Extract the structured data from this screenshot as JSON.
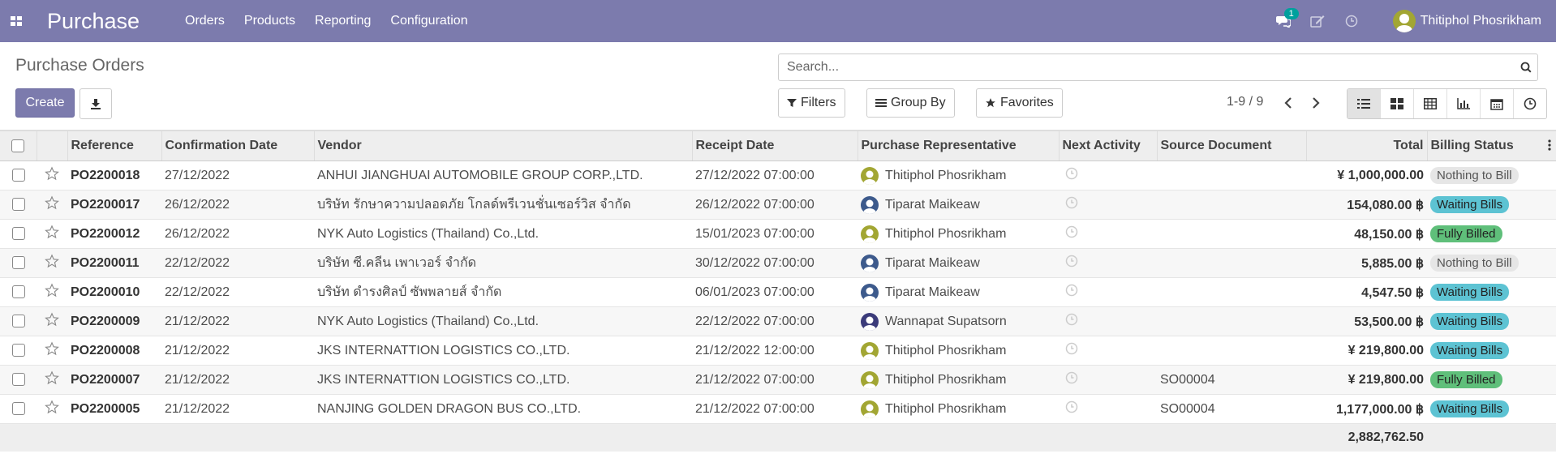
{
  "app": {
    "title": "Purchase"
  },
  "menu": [
    {
      "label": "Orders"
    },
    {
      "label": "Products"
    },
    {
      "label": "Reporting"
    },
    {
      "label": "Configuration"
    }
  ],
  "topbar": {
    "message_count": "1",
    "user_name": "Thitiphol Phosrikham"
  },
  "page": {
    "title": "Purchase Orders",
    "create_label": "Create",
    "search_placeholder": "Search...",
    "filters_label": "Filters",
    "groupby_label": "Group By",
    "favorites_label": "Favorites",
    "pager": "1-9 / 9"
  },
  "colors": {
    "brand": "#7c7bad",
    "waiting": "#5dc3d3",
    "billed": "#5fbf7a",
    "nothing": "#e6e6e6"
  },
  "table": {
    "headers": {
      "reference": "Reference",
      "confirmation": "Confirmation Date",
      "vendor": "Vendor",
      "receipt": "Receipt Date",
      "rep": "Purchase Representative",
      "activity": "Next Activity",
      "source": "Source Document",
      "total": "Total",
      "billing": "Billing Status"
    },
    "rows": [
      {
        "ref": "PO2200018",
        "confirm": "27/12/2022",
        "vendor": "ANHUI JIANGHUAI AUTOMOBILE GROUP CORP.,LTD.",
        "receipt": "27/12/2022 07:00:00",
        "rep": "Thitiphol Phosrikham",
        "source": "",
        "total": "¥ 1,000,000.00",
        "billing": "Nothing to Bill"
      },
      {
        "ref": "PO2200017",
        "confirm": "26/12/2022",
        "vendor": "บริษัท รักษาความปลอดภัย โกลด์พรีเวนชั่นเซอร์วิส จำกัด",
        "receipt": "26/12/2022 07:00:00",
        "rep": "Tiparat Maikeaw",
        "source": "",
        "total": "154,080.00 ฿",
        "billing": "Waiting Bills"
      },
      {
        "ref": "PO2200012",
        "confirm": "26/12/2022",
        "vendor": "NYK Auto Logistics (Thailand) Co.,Ltd.",
        "receipt": "15/01/2023 07:00:00",
        "rep": "Thitiphol Phosrikham",
        "source": "",
        "total": "48,150.00 ฿",
        "billing": "Fully Billed"
      },
      {
        "ref": "PO2200011",
        "confirm": "22/12/2022",
        "vendor": "บริษัท ซี.คลีน เพาเวอร์ จำกัด",
        "receipt": "30/12/2022 07:00:00",
        "rep": "Tiparat Maikeaw",
        "source": "",
        "total": "5,885.00 ฿",
        "billing": "Nothing to Bill"
      },
      {
        "ref": "PO2200010",
        "confirm": "22/12/2022",
        "vendor": "บริษัท ดำรงศิลป์ ซัพพลายส์ จำกัด",
        "receipt": "06/01/2023 07:00:00",
        "rep": "Tiparat Maikeaw",
        "source": "",
        "total": "4,547.50 ฿",
        "billing": "Waiting Bills"
      },
      {
        "ref": "PO2200009",
        "confirm": "21/12/2022",
        "vendor": "NYK Auto Logistics (Thailand) Co.,Ltd.",
        "receipt": "22/12/2022 07:00:00",
        "rep": "Wannapat Supatsorn",
        "source": "",
        "total": "53,500.00 ฿",
        "billing": "Waiting Bills"
      },
      {
        "ref": "PO2200008",
        "confirm": "21/12/2022",
        "vendor": "JKS INTERNATTION LOGISTICS CO.,LTD.",
        "receipt": "21/12/2022 12:00:00",
        "rep": "Thitiphol Phosrikham",
        "source": "",
        "total": "¥ 219,800.00",
        "billing": "Waiting Bills"
      },
      {
        "ref": "PO2200007",
        "confirm": "21/12/2022",
        "vendor": "JKS INTERNATTION LOGISTICS CO.,LTD.",
        "receipt": "21/12/2022 07:00:00",
        "rep": "Thitiphol Phosrikham",
        "source": "SO00004",
        "total": "¥ 219,800.00",
        "billing": "Fully Billed"
      },
      {
        "ref": "PO2200005",
        "confirm": "21/12/2022",
        "vendor": "NANJING GOLDEN DRAGON BUS CO.,LTD.",
        "receipt": "21/12/2022 07:00:00",
        "rep": "Thitiphol Phosrikham",
        "source": "SO00004",
        "total": "1,177,000.00 ฿",
        "billing": "Waiting Bills"
      }
    ],
    "footer_total": "2,882,762.50"
  }
}
